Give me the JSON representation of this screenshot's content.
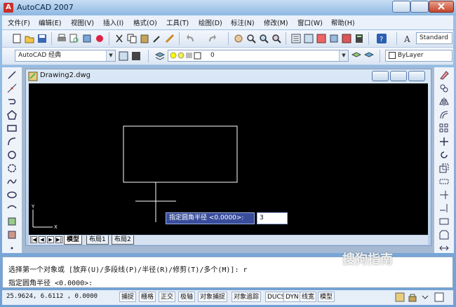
{
  "window": {
    "title": "AutoCAD 2007"
  },
  "menu": [
    "文件(F)",
    "编辑(E)",
    "视图(V)",
    "插入(I)",
    "格式(O)",
    "工具(T)",
    "绘图(D)",
    "标注(N)",
    "修改(M)",
    "窗口(W)",
    "帮助(H)"
  ],
  "toolbar": {
    "text_style": "Standard",
    "workspace": "AutoCAD 经典",
    "layer": "0",
    "color": "ByLayer"
  },
  "drawing": {
    "title": "Drawing2.dwg"
  },
  "prompt": {
    "label": "指定圆角半径 <0.0000>:",
    "value": "3"
  },
  "tabs": [
    "模型",
    "布局1",
    "布局2"
  ],
  "axis": {
    "y": "Y",
    "x": "X"
  },
  "command": {
    "line1": "选择第一个对象或 [放弃(U)/多段线(P)/半径(R)/修剪(T)/多个(M)]: r",
    "line2": "指定圆角半径 <0.0000>:"
  },
  "status": {
    "coords": "25.9624, 6.6112 , 0.0000",
    "buttons": [
      "捕捉",
      "栅格",
      "正交",
      "极轴",
      "对象捕捉",
      "对象追踪",
      "DUCS",
      "DYN",
      "线宽",
      "模型"
    ]
  },
  "watermark": "搜狗指南",
  "colors": {
    "canvas": "#000000",
    "prompt_bg": "#3a4d9b"
  }
}
